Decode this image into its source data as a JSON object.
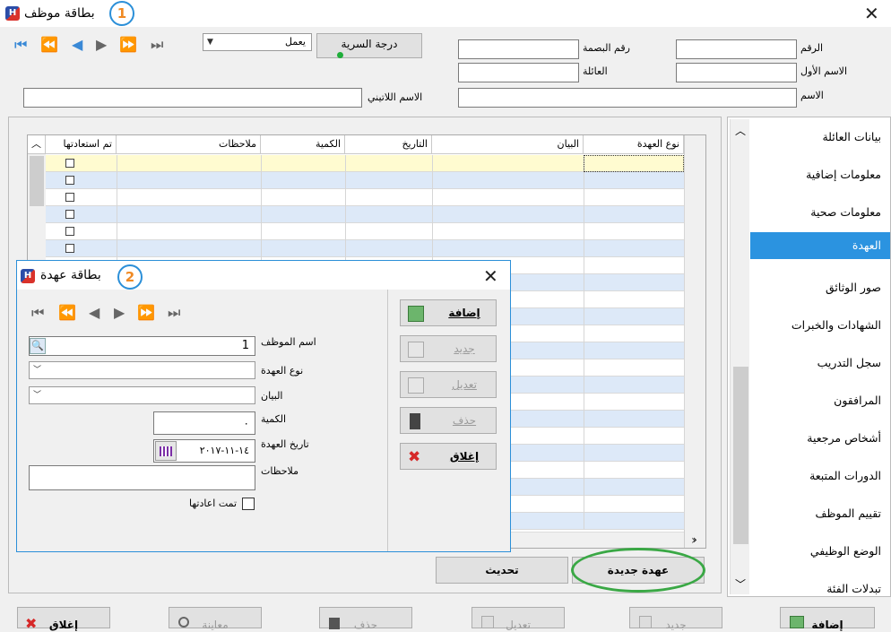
{
  "main_window": {
    "title": "بطاقة موظف",
    "badge": "1",
    "status_combo": "يعمل",
    "secrecy_button": "درجة السرية",
    "fields": {
      "number_label": "الرقم",
      "fingerprint_label": "رقم البصمة",
      "first_name_label": "الاسم الأول",
      "family_label": "العائلة",
      "name_label": "الاسم",
      "latin_name_label": "الاسم اللاتيني"
    }
  },
  "sidebar": {
    "items": [
      {
        "label": "بيانات العائلة"
      },
      {
        "label": "معلومات إضافية"
      },
      {
        "label": "معلومات صحية"
      },
      {
        "label": "العهدة",
        "active": true
      },
      {
        "label": "صور الوثائق"
      },
      {
        "label": "الشهادات والخبرات"
      },
      {
        "label": "سجل التدريب"
      },
      {
        "label": "المرافقون"
      },
      {
        "label": "أشخاص مرجعية"
      },
      {
        "label": "الدورات المتبعة"
      },
      {
        "label": "تقييم الموظف"
      },
      {
        "label": "الوضع الوظيفي"
      },
      {
        "label": "تبدلات الفئة"
      }
    ]
  },
  "grid": {
    "columns": [
      "نوع العهدة",
      "البيان",
      "التاريخ",
      "الكمية",
      "ملاحظات",
      "تم استعادتها"
    ]
  },
  "panel_buttons": {
    "refresh": "تحديث",
    "new_custody": "عهدة جديدة"
  },
  "dialog": {
    "title": "بطاقة عهدة",
    "badge": "2",
    "employee_name_label": "اسم الموظف",
    "employee_name_value": "1",
    "custody_type_label": "نوع العهدة",
    "statement_label": "البيان",
    "quantity_label": "الكمية",
    "quantity_value": "٠",
    "custody_date_label": "تاريخ العهدة",
    "custody_date_value": "١٤-١١-٢٠١٧",
    "notes_label": "ملاحظات",
    "returned_label": "تمت اعادتها",
    "buttons": {
      "add": "إضافة",
      "new": "جديد",
      "edit": "تعديل",
      "delete": "حذف",
      "close": "إغلاق"
    }
  },
  "bottom_toolbar": {
    "add": "إضافة",
    "new": "جديد",
    "edit": "تعديل",
    "delete": "حذف",
    "preview": "معاينة",
    "close": "إغلاق"
  },
  "colors": {
    "accent": "#2b93e0",
    "selected_row": "#fffbd0",
    "alt_row": "#dde9f8",
    "highlight_ellipse": "#3aa845"
  }
}
